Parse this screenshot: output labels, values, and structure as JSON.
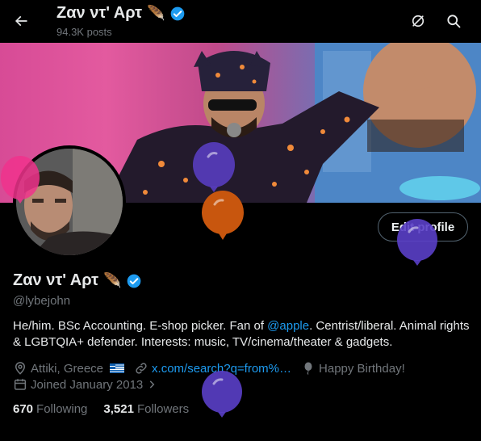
{
  "header": {
    "name": "Ζαν ντ' Αρτ",
    "name_emoji": "🪶",
    "posts_count": "94.3K posts"
  },
  "profile": {
    "name": "Ζαν ντ' Αρτ",
    "name_emoji": "🪶",
    "handle": "@lybejohn",
    "edit_button_label": "Edit profile",
    "bio_part1": "He/him. BSc Accounting. E-shop picker. Fan of ",
    "bio_mention": "@apple",
    "bio_part2": ". Centrist/liberal. Animal rights & LGBTQIA+ defender. Interests: music, TV/cinema/theater & gadgets.",
    "location": "Attiki, Greece",
    "website": "x.com/search?q=from%…",
    "birthday": "Happy Birthday!",
    "joined": "Joined January 2013"
  },
  "stats": {
    "following_count": "670",
    "following_label": "Following",
    "followers_count": "3,521",
    "followers_label": "Followers"
  },
  "colors": {
    "background": "#000000",
    "text": "#e7e9ea",
    "secondary_text": "#71767b",
    "link": "#1d9bf0",
    "verified": "#1d9bf0",
    "balloon_pink": "#f0328c",
    "balloon_purple": "#5a3fc8",
    "balloon_orange": "#c8560e"
  },
  "icons": [
    "back-arrow-icon",
    "verified-badge-icon",
    "feather-icon",
    "sync-icon",
    "search-icon",
    "location-icon",
    "link-icon",
    "balloon-icon",
    "calendar-icon",
    "chevron-right-icon"
  ]
}
